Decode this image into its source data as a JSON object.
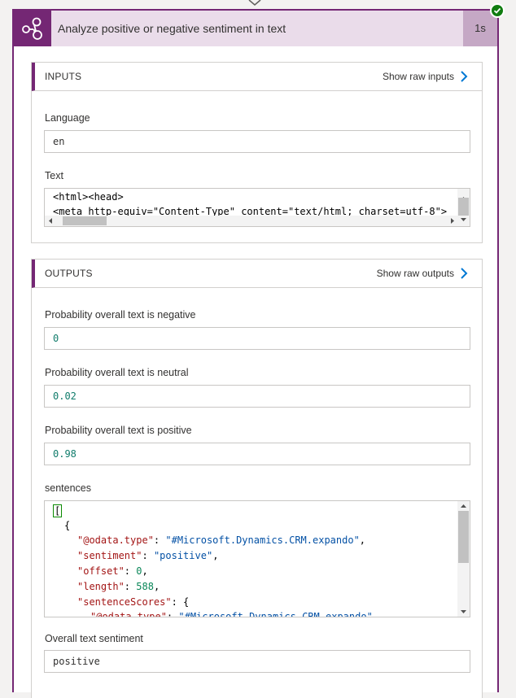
{
  "action": {
    "title": "Analyze positive or negative sentiment in text",
    "duration": "1s",
    "status": "succeeded",
    "accent_color": "#742774",
    "header_bg_color": "#eadcea",
    "success_color": "#107c10"
  },
  "inputs": {
    "section_title": "INPUTS",
    "raw_link": "Show raw inputs",
    "language_label": "Language",
    "language_value": "en",
    "text_label": "Text",
    "text_lines": [
      "<html><head>",
      "<meta http-equiv=\"Content-Type\" content=\"text/html; charset=utf-8\">"
    ]
  },
  "outputs": {
    "section_title": "OUTPUTS",
    "raw_link": "Show raw outputs",
    "negative_label": "Probability overall text is negative",
    "negative_value": "0",
    "neutral_label": "Probability overall text is neutral",
    "neutral_value": "0.02",
    "positive_label": "Probability overall text is positive",
    "positive_value": "0.98",
    "sentences_label": "sentences",
    "sentences": {
      "open_bracket": "[",
      "open_brace": "{",
      "odata_type_key": "\"@odata.type\"",
      "odata_type_value": "\"#Microsoft.Dynamics.CRM.expando\"",
      "sentiment_key": "\"sentiment\"",
      "sentiment_value": "\"positive\"",
      "offset_key": "\"offset\"",
      "offset_value": "0",
      "length_key": "\"length\"",
      "length_value": "588",
      "scores_key": "\"sentenceScores\"",
      "scores_open": "{",
      "nested_odata_key": "\"@odata.type\"",
      "nested_odata_value": "\"#Microsoft.Dynamics.CRM.expando\""
    },
    "overall_label": "Overall text sentiment",
    "overall_value": "positive"
  }
}
